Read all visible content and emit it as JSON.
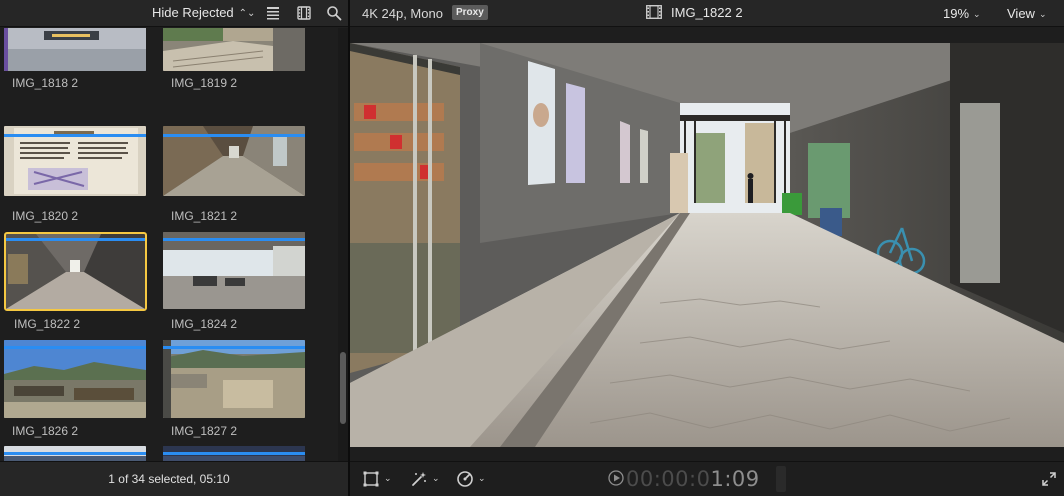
{
  "browser": {
    "filter_label": "Hide Rejected",
    "status": "1 of 34 selected, 05:10",
    "clips": [
      {
        "name": "IMG_1818 2",
        "selected": false
      },
      {
        "name": "IMG_1819 2",
        "selected": false
      },
      {
        "name": "IMG_1820 2",
        "selected": false
      },
      {
        "name": "IMG_1821 2",
        "selected": false
      },
      {
        "name": "IMG_1822 2",
        "selected": true
      },
      {
        "name": "IMG_1824 2",
        "selected": false
      },
      {
        "name": "IMG_1826 2",
        "selected": false
      },
      {
        "name": "IMG_1827 2",
        "selected": false
      }
    ]
  },
  "viewer": {
    "format": "4K 24p, Mono",
    "proxy_badge": "Proxy",
    "clip_title": "IMG_1822 2",
    "zoom": "19%",
    "view_label": "View",
    "timecode_dim": "00:00:0",
    "timecode_lit": "1:09"
  },
  "icons": [
    "chevron-updown-icon",
    "list-view-icon",
    "filmstrip-view-icon",
    "search-icon",
    "film-icon",
    "transform-icon",
    "magic-wand-icon",
    "speed-gauge-icon",
    "play-icon",
    "fullscreen-icon"
  ],
  "colors": {
    "selection_outline": "#f5c842",
    "keyword_bar": "#2a8df2",
    "panel_bg": "#1e1e1e",
    "toolbar_bg": "#262626"
  }
}
